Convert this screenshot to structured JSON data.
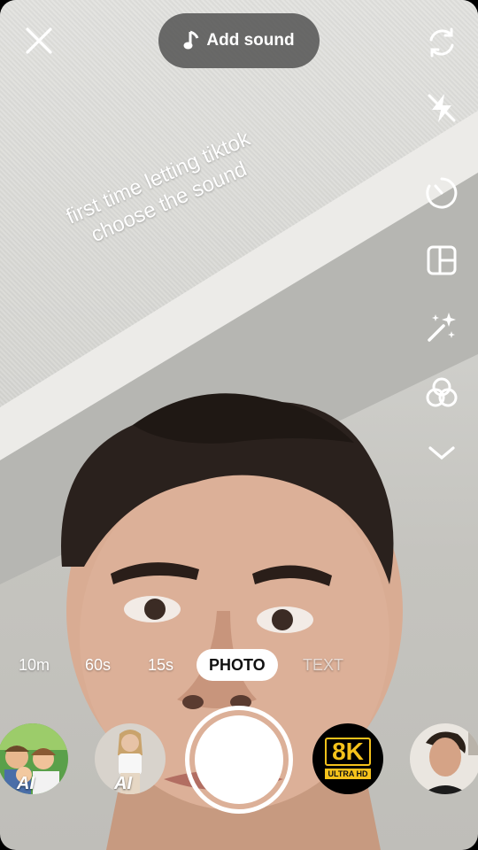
{
  "top_bar": {
    "close_icon": "close-icon",
    "add_sound_label": "Add sound",
    "music_icon": "music-note-icon"
  },
  "caption_lines": [
    "first time letting tiktok",
    "choose the sound"
  ],
  "toolbar": [
    {
      "name": "flip-camera",
      "icon": "flip-camera-icon"
    },
    {
      "name": "flash",
      "icon": "flash-off-icon"
    },
    {
      "name": "timer",
      "icon": "timer-icon"
    },
    {
      "name": "layout",
      "icon": "layout-grid-icon"
    },
    {
      "name": "effects",
      "icon": "magic-wand-icon"
    },
    {
      "name": "filters",
      "icon": "filters-icon"
    },
    {
      "name": "more",
      "icon": "chevron-down-icon"
    }
  ],
  "modes": [
    {
      "label": "10m",
      "active": false
    },
    {
      "label": "60s",
      "active": false
    },
    {
      "label": "15s",
      "active": false
    },
    {
      "label": "PHOTO",
      "active": true
    },
    {
      "label": "TEXT",
      "active": false
    }
  ],
  "effects": [
    {
      "name": "ai-family-cartoon",
      "badge": "AI"
    },
    {
      "name": "ai-portrait",
      "badge": "AI"
    },
    {
      "name": "8k-ultra-hd",
      "badge_main": "8K",
      "badge_sub": "ULTRA HD"
    },
    {
      "name": "face-effect",
      "badge": ""
    }
  ],
  "colors": {
    "pill_bg": "#464646",
    "white": "#ffffff",
    "gold": "#f5c21b"
  }
}
